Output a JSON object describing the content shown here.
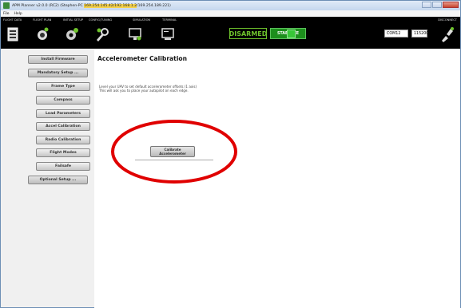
{
  "window": {
    "title_prefix": "APM Planner v2.0.0 (RC2) (Stephen-PC ",
    "title_highlight": "169.254.145.42/192.168.1.2",
    "title_suffix": "/169.254.189.221)"
  },
  "menu": [
    "File",
    "Help"
  ],
  "toolbar": {
    "labels": [
      "FLIGHT DATA",
      "FLIGHT PLAN",
      "INITIAL SETUP",
      "CONFIG/TUNING",
      "SIMULATION",
      "TERMINAL"
    ],
    "disconnect_label": "DISCONNECT",
    "armed_status": "DISARMED",
    "flight_mode": "STABILIZE",
    "com_port": "COM12",
    "baud_rate": "115200",
    "colors": {
      "armed_text": "#6ec32c",
      "mode_bg": "#1d8f1d",
      "led": "#37c637"
    }
  },
  "sidebar": {
    "items": [
      {
        "label": "Install Firmware"
      },
      {
        "label": "Mandatory Setup ..."
      },
      {
        "label": "Frame Type"
      },
      {
        "label": "Compass"
      },
      {
        "label": "Load Parameters"
      },
      {
        "label": "Accel Calibration"
      },
      {
        "label": "Radio Calibration"
      },
      {
        "label": "Flight Modes"
      },
      {
        "label": "Failsafe"
      },
      {
        "label": "Optional Setup ..."
      }
    ]
  },
  "main": {
    "title": "Accelerometer Calibration",
    "instructions_line1": "Level your UAV to set default accelerometer offsets (1 axis)",
    "instructions_line2": "This will ask you to place your autopilot on each edge.",
    "calibrate_line1": "Calibrate",
    "calibrate_line2": "Accelerometer",
    "highlight_color": "#e00000"
  }
}
